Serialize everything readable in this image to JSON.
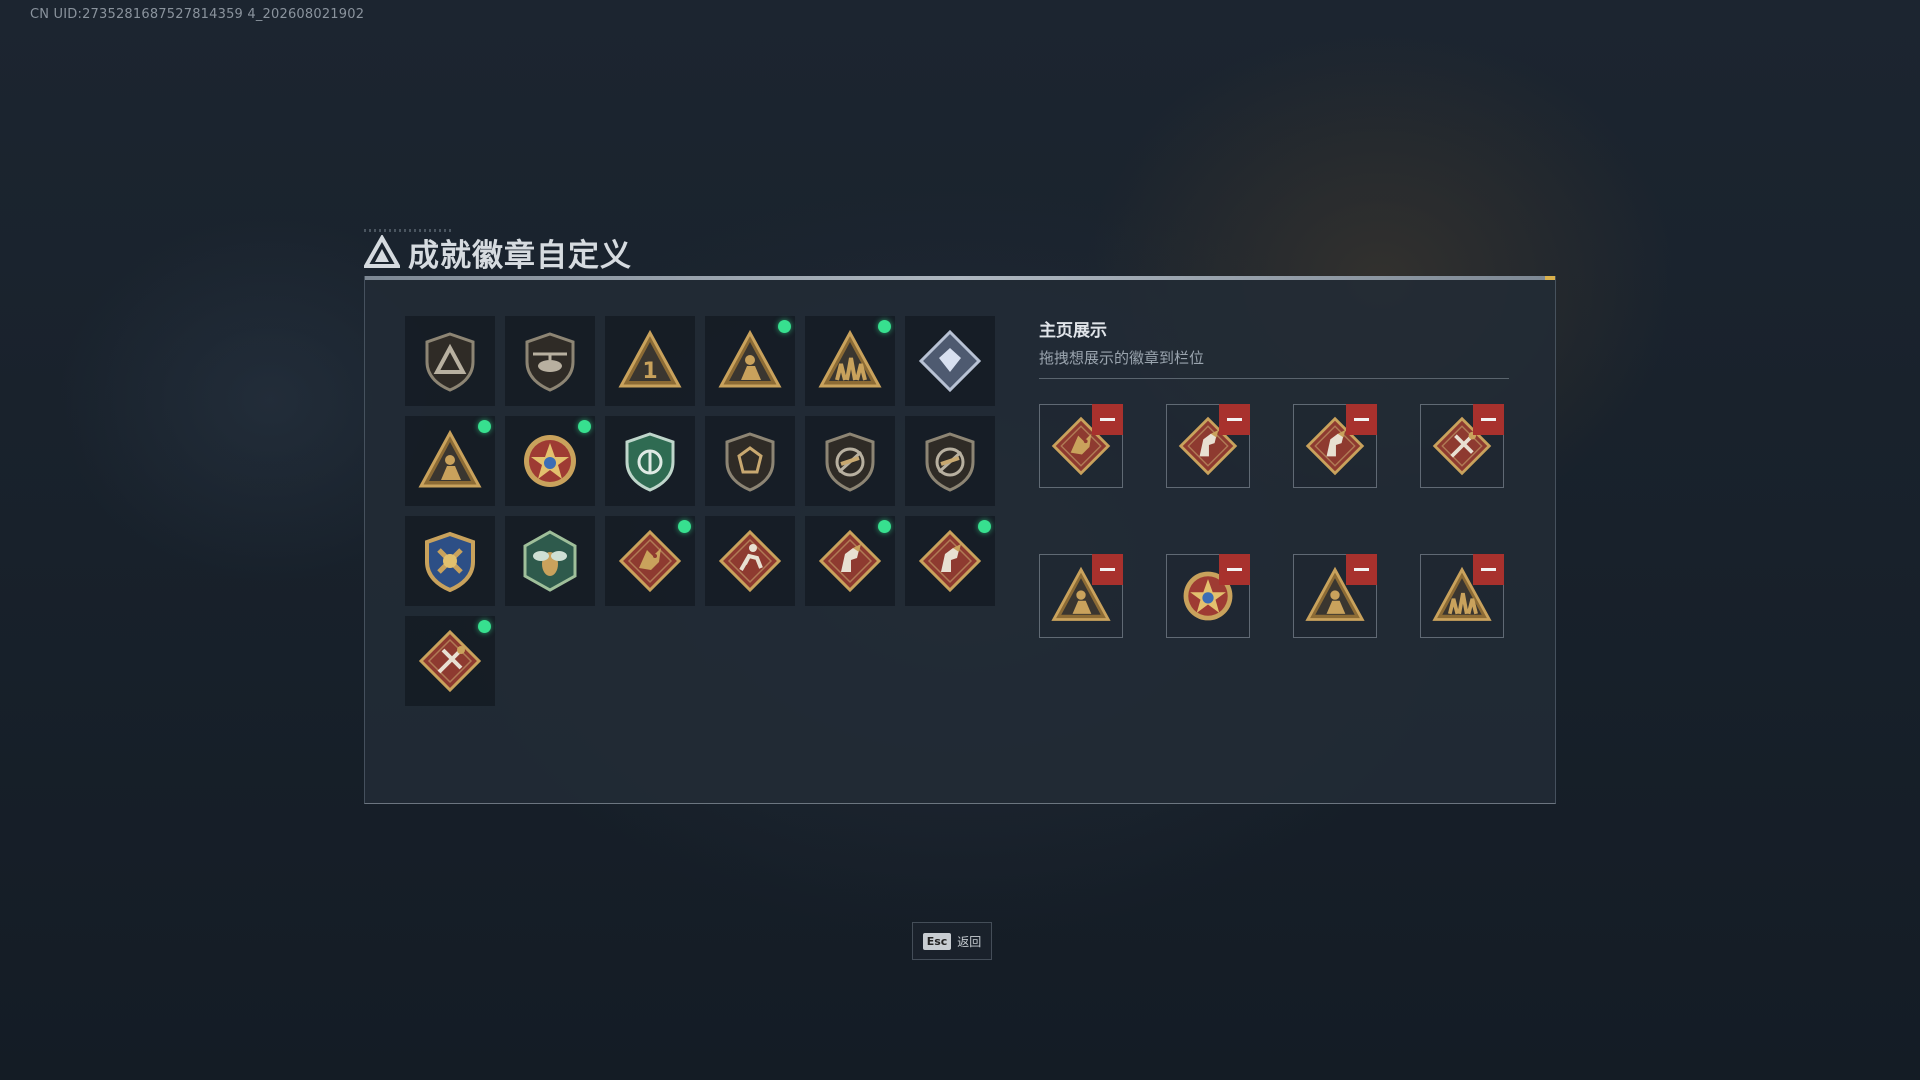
{
  "uid_text": "CN UID:2735281687527814359 4_202608021902",
  "title": "成就徽章自定义",
  "side": {
    "title": "主页展示",
    "subtitle": "拖拽想展示的徽章到栏位"
  },
  "esc": {
    "key": "Esc",
    "label": "返回"
  },
  "colors": {
    "new_dot": "#37e08f",
    "remove": "#a8312d",
    "gold": "#c9a25c"
  },
  "badges": [
    {
      "icon": "tri-logo-shield-icon",
      "is_new": false
    },
    {
      "icon": "helicopter-shield-icon",
      "is_new": false
    },
    {
      "icon": "rank-one-triangle-icon",
      "is_new": false
    },
    {
      "icon": "kneeling-soldier-triangle-icon",
      "is_new": true
    },
    {
      "icon": "squad-triangle-icon",
      "is_new": true
    },
    {
      "icon": "crystal-diamond-icon",
      "is_new": false
    },
    {
      "icon": "backpack-soldier-triangle-icon",
      "is_new": true
    },
    {
      "icon": "star-medal-icon",
      "is_new": true
    },
    {
      "icon": "green-shield-icon",
      "is_new": false
    },
    {
      "icon": "armor-shield-icon",
      "is_new": false
    },
    {
      "icon": "no-rifle-shield-icon",
      "is_new": false
    },
    {
      "icon": "no-gun-shield-icon",
      "is_new": false
    },
    {
      "icon": "wrench-crest-icon",
      "is_new": false
    },
    {
      "icon": "bee-hexagon-icon",
      "is_new": false
    },
    {
      "icon": "dragon-diamond-icon",
      "is_new": true
    },
    {
      "icon": "runner-diamond-icon",
      "is_new": false
    },
    {
      "icon": "horse-diamond-icon",
      "is_new": true
    },
    {
      "icon": "horse-diamond-alt-icon",
      "is_new": true
    },
    {
      "icon": "tools-diamond-icon",
      "is_new": true
    }
  ],
  "showcase_slots": [
    {
      "icon": "dragon-diamond-icon"
    },
    {
      "icon": "horse-diamond-icon"
    },
    {
      "icon": "horse-diamond-alt-icon"
    },
    {
      "icon": "tools-diamond-icon"
    },
    {
      "icon": "backpack-soldier-triangle-icon"
    },
    {
      "icon": "star-medal-icon"
    },
    {
      "icon": "kneeling-soldier-triangle-icon"
    },
    {
      "icon": "squad-triangle-icon"
    }
  ]
}
